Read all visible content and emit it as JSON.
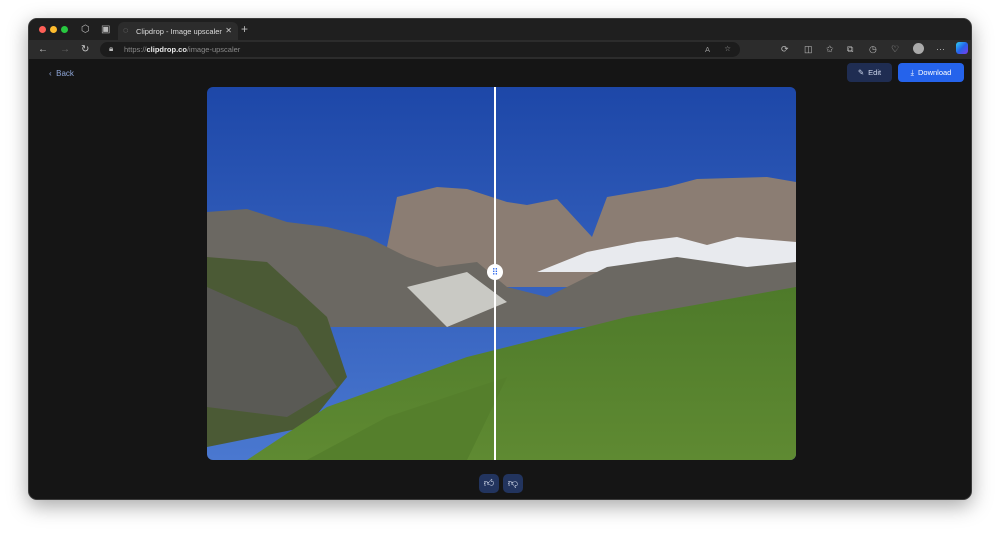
{
  "browser": {
    "tab_title": "Clipdrop - Image upscaler",
    "new_tab": "+",
    "url_prefix": "https://",
    "url_domain": "clipdrop.co",
    "url_path": "/image-upscaler"
  },
  "page": {
    "back_label": "Back",
    "edit_label": "Edit",
    "download_label": "Download"
  },
  "colors": {
    "accent": "#2563eb",
    "edit_bg": "#1f2d52",
    "bg": "#151515"
  }
}
